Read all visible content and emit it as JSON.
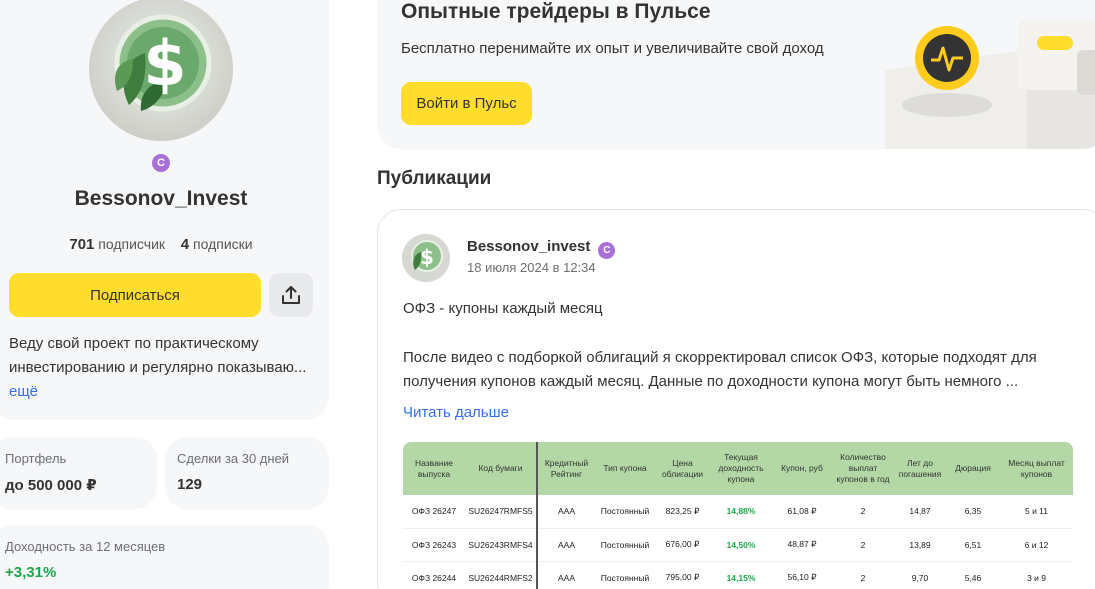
{
  "profile": {
    "name": "Bessonov_Invest",
    "followers_count": "701",
    "followers_label": "подписчик",
    "following_count": "4",
    "following_label": "подписки",
    "subscribe_label": "Подписаться",
    "bio_line1": "Веду свой проект по практическому",
    "bio_line2": "инвестированию и регулярно показываю...",
    "bio_more": "ещё",
    "verified_glyph": "C",
    "badge_color": "#a970d8"
  },
  "stats": {
    "portfolio_label": "Портфель",
    "portfolio_value": "до 500 000 ₽",
    "deals_label": "Сделки за 30 дней",
    "deals_value": "129",
    "yield_label": "Доходность за 12 месяцев",
    "yield_value": "+3,31%"
  },
  "promo": {
    "title": "Опытные трейдеры в Пульсе",
    "subtitle": "Бесплатно перенимайте их опыт и увеличивайте свой доход",
    "button_label": "Войти в Пульс"
  },
  "publications": {
    "section_title": "Публикации",
    "post": {
      "author": "Bessonov_invest",
      "date": "18 июля 2024 в 12:34",
      "heading": "ОФЗ - купоны каждый месяц",
      "body_line1": "После видео с подборкой облигаций я скорректировал список ОФЗ, которые подходят для",
      "body_line2": "получения купонов каждый месяц. Данные по доходности купона могут быть немного ...",
      "read_more": "Читать дальше",
      "table": {
        "headers": [
          "Название выпуска",
          "Код бумаги",
          "Кредитный Рейтинг",
          "Тип купона",
          "Цена облигации",
          "Текущая доходность купона",
          "Купон, руб",
          "Количество выплат купонов в год",
          "Лет до погашения",
          "Дюрация",
          "Месяц выплат купонов"
        ],
        "rows": [
          [
            "ОФЗ 26247",
            "SU26247RMFS5",
            "AAA",
            "Постоянный",
            "823,25 ₽",
            "14,88%",
            "61,08 ₽",
            "2",
            "14,87",
            "6,35",
            "5 и 11"
          ],
          [
            "ОФЗ 26243",
            "SU26243RMFS4",
            "AAA",
            "Постоянный",
            "676,00 ₽",
            "14,50%",
            "48,87 ₽",
            "2",
            "13,89",
            "6,51",
            "6 и 12"
          ],
          [
            "ОФЗ 26244",
            "SU26244RMFS2",
            "AAA",
            "Постоянный",
            "795,00 ₽",
            "14,15%",
            "56,10 ₽",
            "2",
            "9,70",
            "5,46",
            "3 и 9"
          ]
        ]
      }
    }
  },
  "colors": {
    "accent_yellow": "#ffdd2d",
    "link_blue": "#336fee",
    "positive_green": "#1fa64a",
    "table_header_green": "#b3d8a5"
  },
  "icons": {
    "avatar": "dollar-leaf-coin",
    "share": "share-upload-icon",
    "verified": "verified-badge-icon"
  }
}
